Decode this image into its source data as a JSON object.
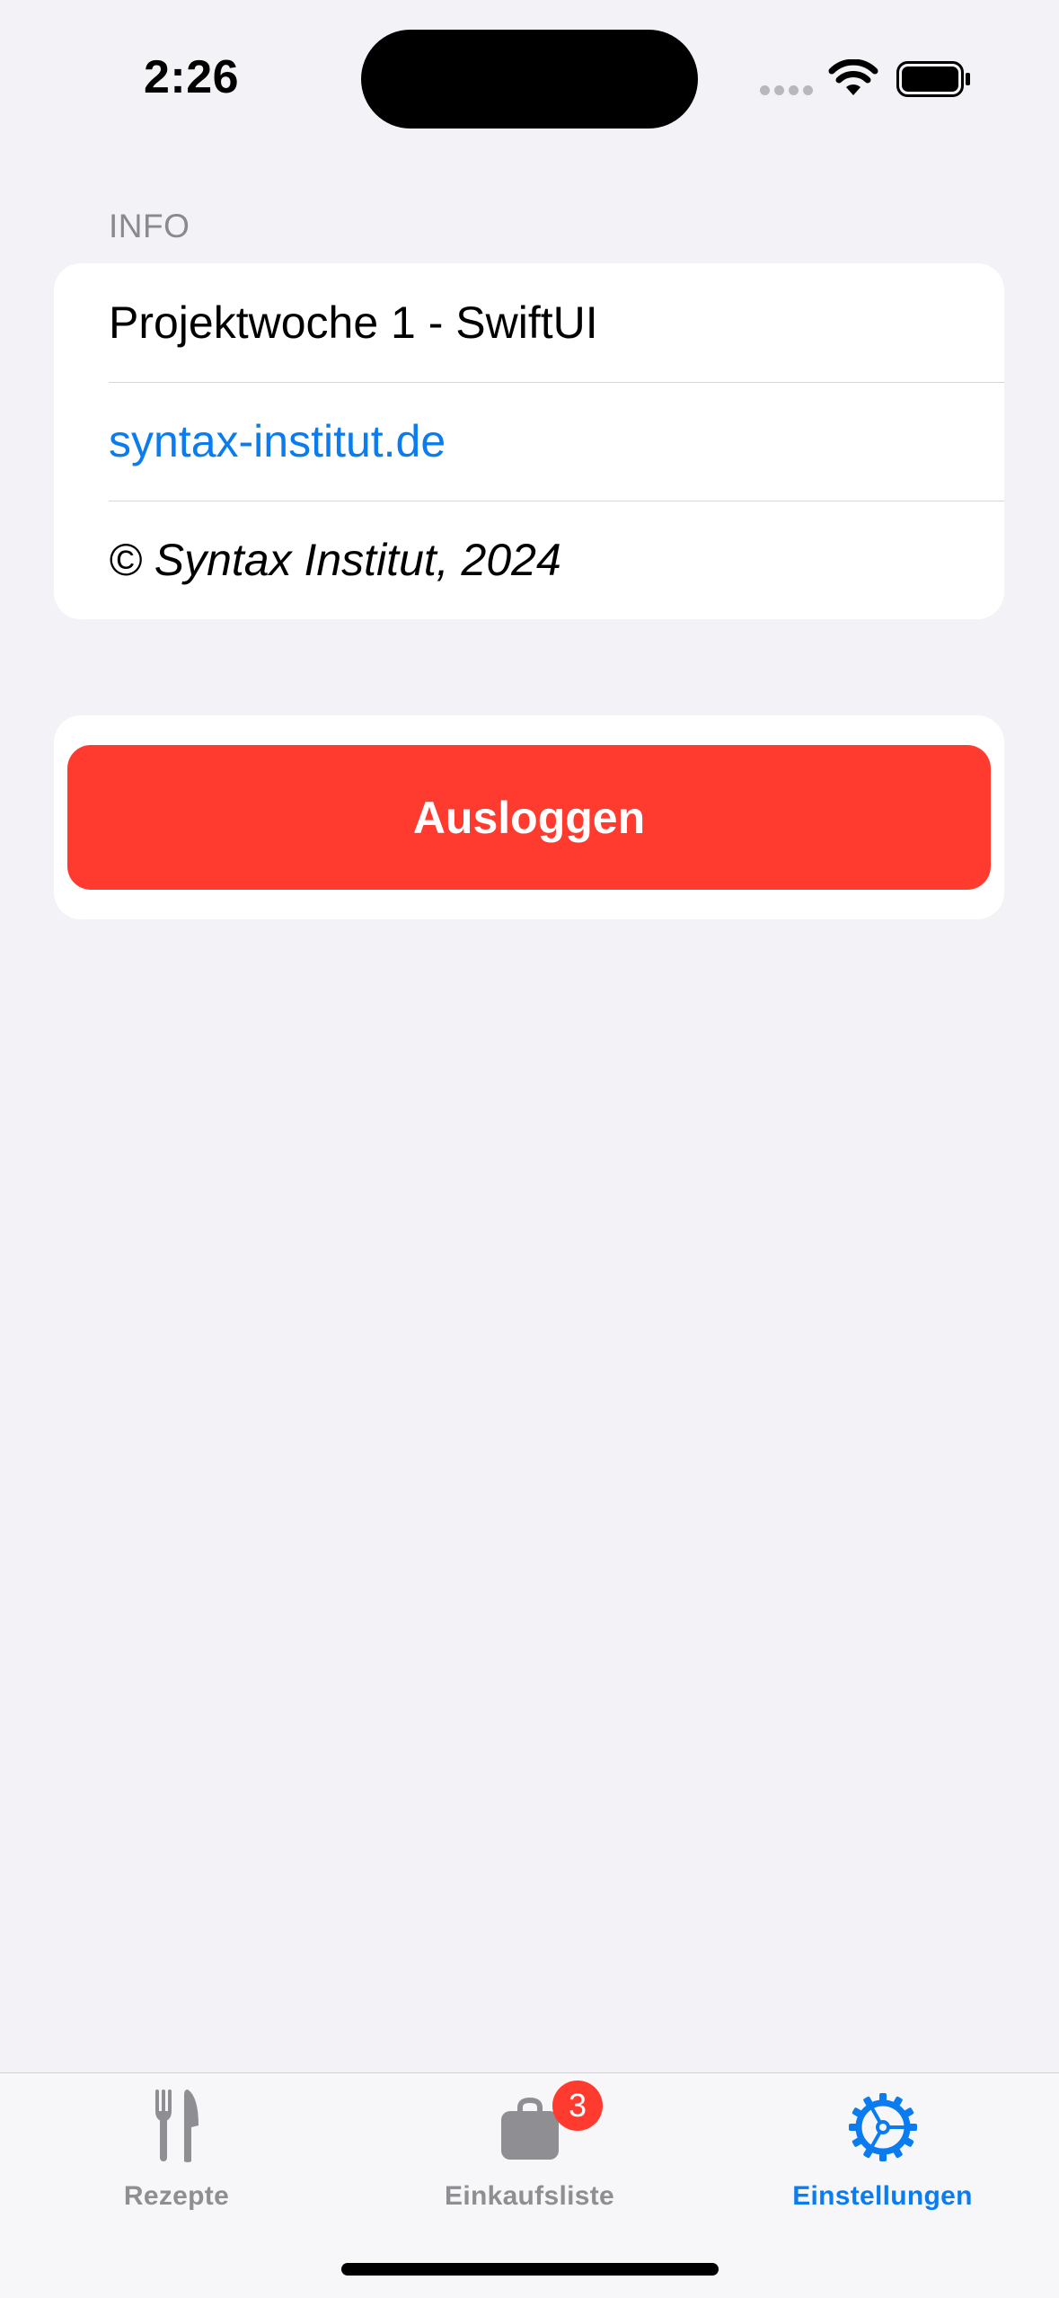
{
  "status_bar": {
    "time": "2:26"
  },
  "info_section": {
    "header": "INFO",
    "rows": [
      {
        "label": "Projektwoche 1 - SwiftUI"
      },
      {
        "label": "syntax-institut.de"
      },
      {
        "label": "© Syntax Institut, 2024"
      }
    ]
  },
  "logout": {
    "label": "Ausloggen"
  },
  "tabs": [
    {
      "label": "Rezepte",
      "icon": "fork-knife-icon"
    },
    {
      "label": "Einkaufsliste",
      "icon": "bag-icon",
      "badge": "3"
    },
    {
      "label": "Einstellungen",
      "icon": "gear-icon"
    }
  ],
  "colors": {
    "accent": "#0a7cf0",
    "destructive": "#ff3b30",
    "background": "#f2f2f7",
    "inactive": "#8e8e93"
  }
}
